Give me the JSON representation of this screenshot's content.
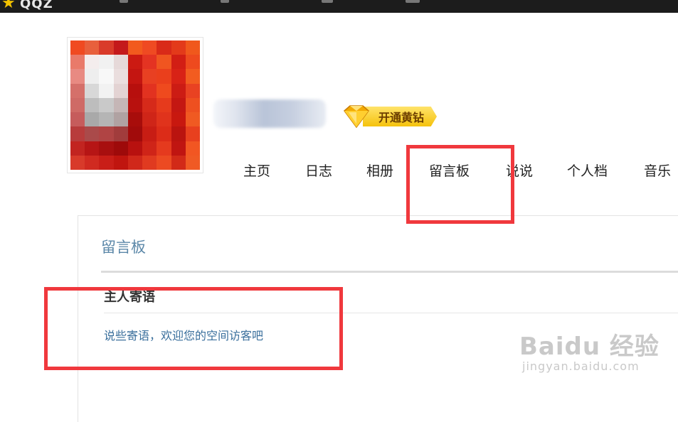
{
  "topbar": {
    "logo_text": "QQZ",
    "icon": "star-icon",
    "colors": {
      "background": "#1c1c1c",
      "logo_star": "#f5c400"
    }
  },
  "profile": {
    "avatar_icon": "avatar-pixelated",
    "vip_badge_label": "开通黄钻",
    "vip_icon": "diamond-icon"
  },
  "nav": {
    "items": [
      {
        "label": "主页"
      },
      {
        "label": "日志"
      },
      {
        "label": "相册"
      },
      {
        "label": "留言板"
      },
      {
        "label": "说说"
      },
      {
        "label": "个人档"
      },
      {
        "label": "音乐"
      }
    ]
  },
  "guestbook": {
    "title": "留言板",
    "host_heading": "主人寄语",
    "host_message": "说些寄语，欢迎您的空间访客吧"
  },
  "watermark": {
    "brand": "Baidu 经验",
    "url": "jingyan.baidu.com"
  },
  "colors": {
    "annotation_red": "#f0383d",
    "title_blue": "#5b87a8",
    "link_blue": "#3a6f9c"
  }
}
